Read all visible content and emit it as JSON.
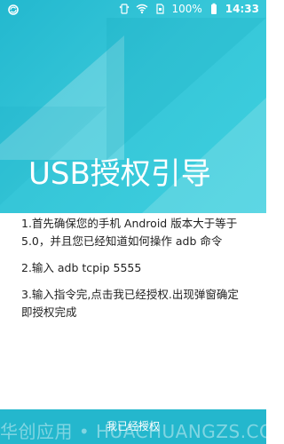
{
  "status_bar": {
    "left_icon": "sync-icon",
    "right_icons": [
      "vibrate-icon",
      "wifi-icon",
      "sim-icon"
    ],
    "battery_text": "100%",
    "battery_icon": "battery-icon",
    "time": "14:33"
  },
  "hero": {
    "title": "USB授权引导",
    "gradient_start": "#23b8cf",
    "gradient_end": "#3ed0df"
  },
  "steps": [
    "1.首先确保您的手机 Android 版本大于等于5.0，并且您已经知道如何操作 adb 命令",
    "2.输入 adb tcpip 5555",
    "3.输入指令完,点击我已经授权.出现弹窗确定即授权完成"
  ],
  "actions": {
    "confirm_label": "我已经授权"
  },
  "watermark": "华创应用 • HUACHUANGZS.COM",
  "colors": {
    "accent": "#24b7cd",
    "text": "#222222",
    "white": "#ffffff"
  }
}
